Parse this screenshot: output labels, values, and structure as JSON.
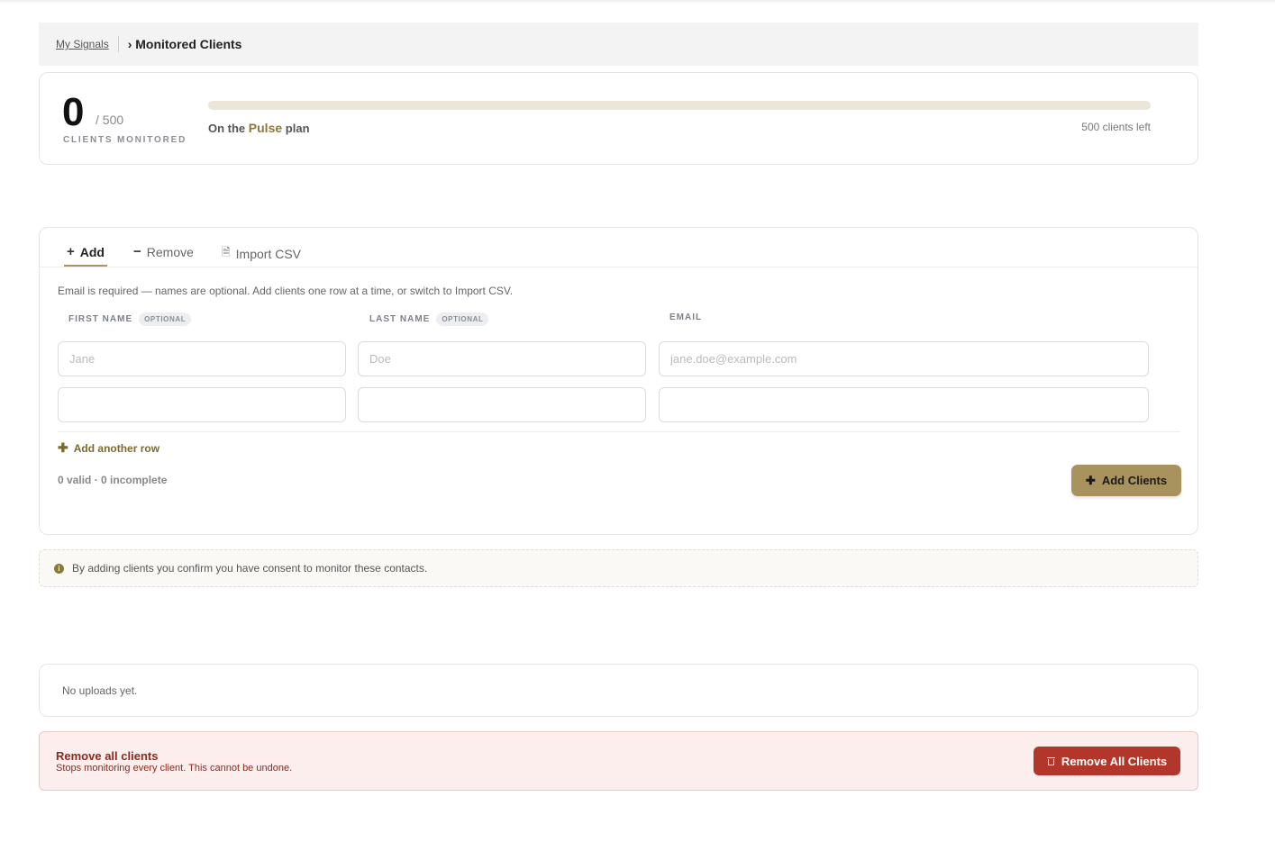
{
  "breadcrumb": {
    "root": "My Signals",
    "current": "› Monitored Clients"
  },
  "usage": {
    "count": "0",
    "total": "/ 500",
    "label": "CLIENTS MONITORED",
    "progress_percent": 0,
    "plan_prefix": "On the",
    "plan_name": "Pulse",
    "plan_suffix": "plan",
    "remaining": "500 clients left"
  },
  "tabs": [
    {
      "label": "Add",
      "icon": "plus-icon",
      "glyph": "+"
    },
    {
      "label": "Remove",
      "icon": "minus-icon",
      "glyph": "−"
    },
    {
      "label": "Import CSV",
      "icon": "document-icon",
      "glyph": "🗎"
    }
  ],
  "form": {
    "helper": "Email is required — names are optional. Add clients one row at a time, or switch to Import CSV.",
    "columns": {
      "first": "FIRST NAME",
      "last": "LAST NAME",
      "email": "EMAIL",
      "optional": "OPTIONAL"
    },
    "placeholders": {
      "first": "Jane",
      "last": "Doe",
      "email": "jane.doe@example.com"
    },
    "add_row": "Add another row",
    "status": "0 valid · 0 incomplete",
    "submit": "Add Clients"
  },
  "consent": "By adding clients you confirm you have consent to monitor these contacts.",
  "uploads": {
    "empty": "No uploads yet."
  },
  "danger": {
    "title": "Remove all clients",
    "subtitle": "Stops monitoring every client. This cannot be undone.",
    "button": "Remove All Clients"
  },
  "colors": {
    "accent": "#a8935e",
    "accent_text": "#7a6a2c",
    "danger": "#b3362b",
    "danger_bg": "#fbeeec"
  }
}
